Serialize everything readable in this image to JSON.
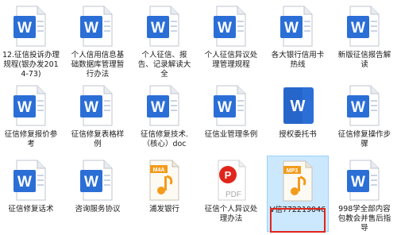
{
  "files": [
    {
      "label": "12.征信投诉办理规程(银办发2014-73)",
      "type": "word"
    },
    {
      "label": "个人信用信息基础数据库管理暂行办法",
      "type": "word"
    },
    {
      "label": "个人征信、报告、记录解读大全",
      "type": "word"
    },
    {
      "label": "个人征信异议处理管理规程",
      "type": "word"
    },
    {
      "label": "各大银行信用卡热线",
      "type": "word"
    },
    {
      "label": "新版征信报告解读",
      "type": "word"
    },
    {
      "label": "征信修复报价参考",
      "type": "word"
    },
    {
      "label": "征信修复表格样例",
      "type": "word"
    },
    {
      "label": "征信修复技术.（核心）doc",
      "type": "word"
    },
    {
      "label": "征信业管理条例",
      "type": "word"
    },
    {
      "label": "授权委托书",
      "type": "word"
    },
    {
      "label": "征信修复操作步骤",
      "type": "word"
    },
    {
      "label": "征信修复话术",
      "type": "word"
    },
    {
      "label": "咨询服务协议",
      "type": "word"
    },
    {
      "label": "浦发银行",
      "type": "m4a",
      "badge": "M4A"
    },
    {
      "label": "征信个人异议处理办法",
      "type": "pdf",
      "badge": "PDF"
    },
    {
      "label": "V信772219046",
      "type": "mp3",
      "badge": "MP3",
      "selected": true
    },
    {
      "label": "998学全部内容包教会并售后指导",
      "type": "word"
    }
  ],
  "colors": {
    "word_blue": "#2b6fd6",
    "word_blue_dark": "#1e57b4",
    "pdf_red": "#e0261b",
    "audio_orange": "#f39b1b",
    "selection_bg": "#cce8ff",
    "highlight_border": "#e0261b"
  }
}
